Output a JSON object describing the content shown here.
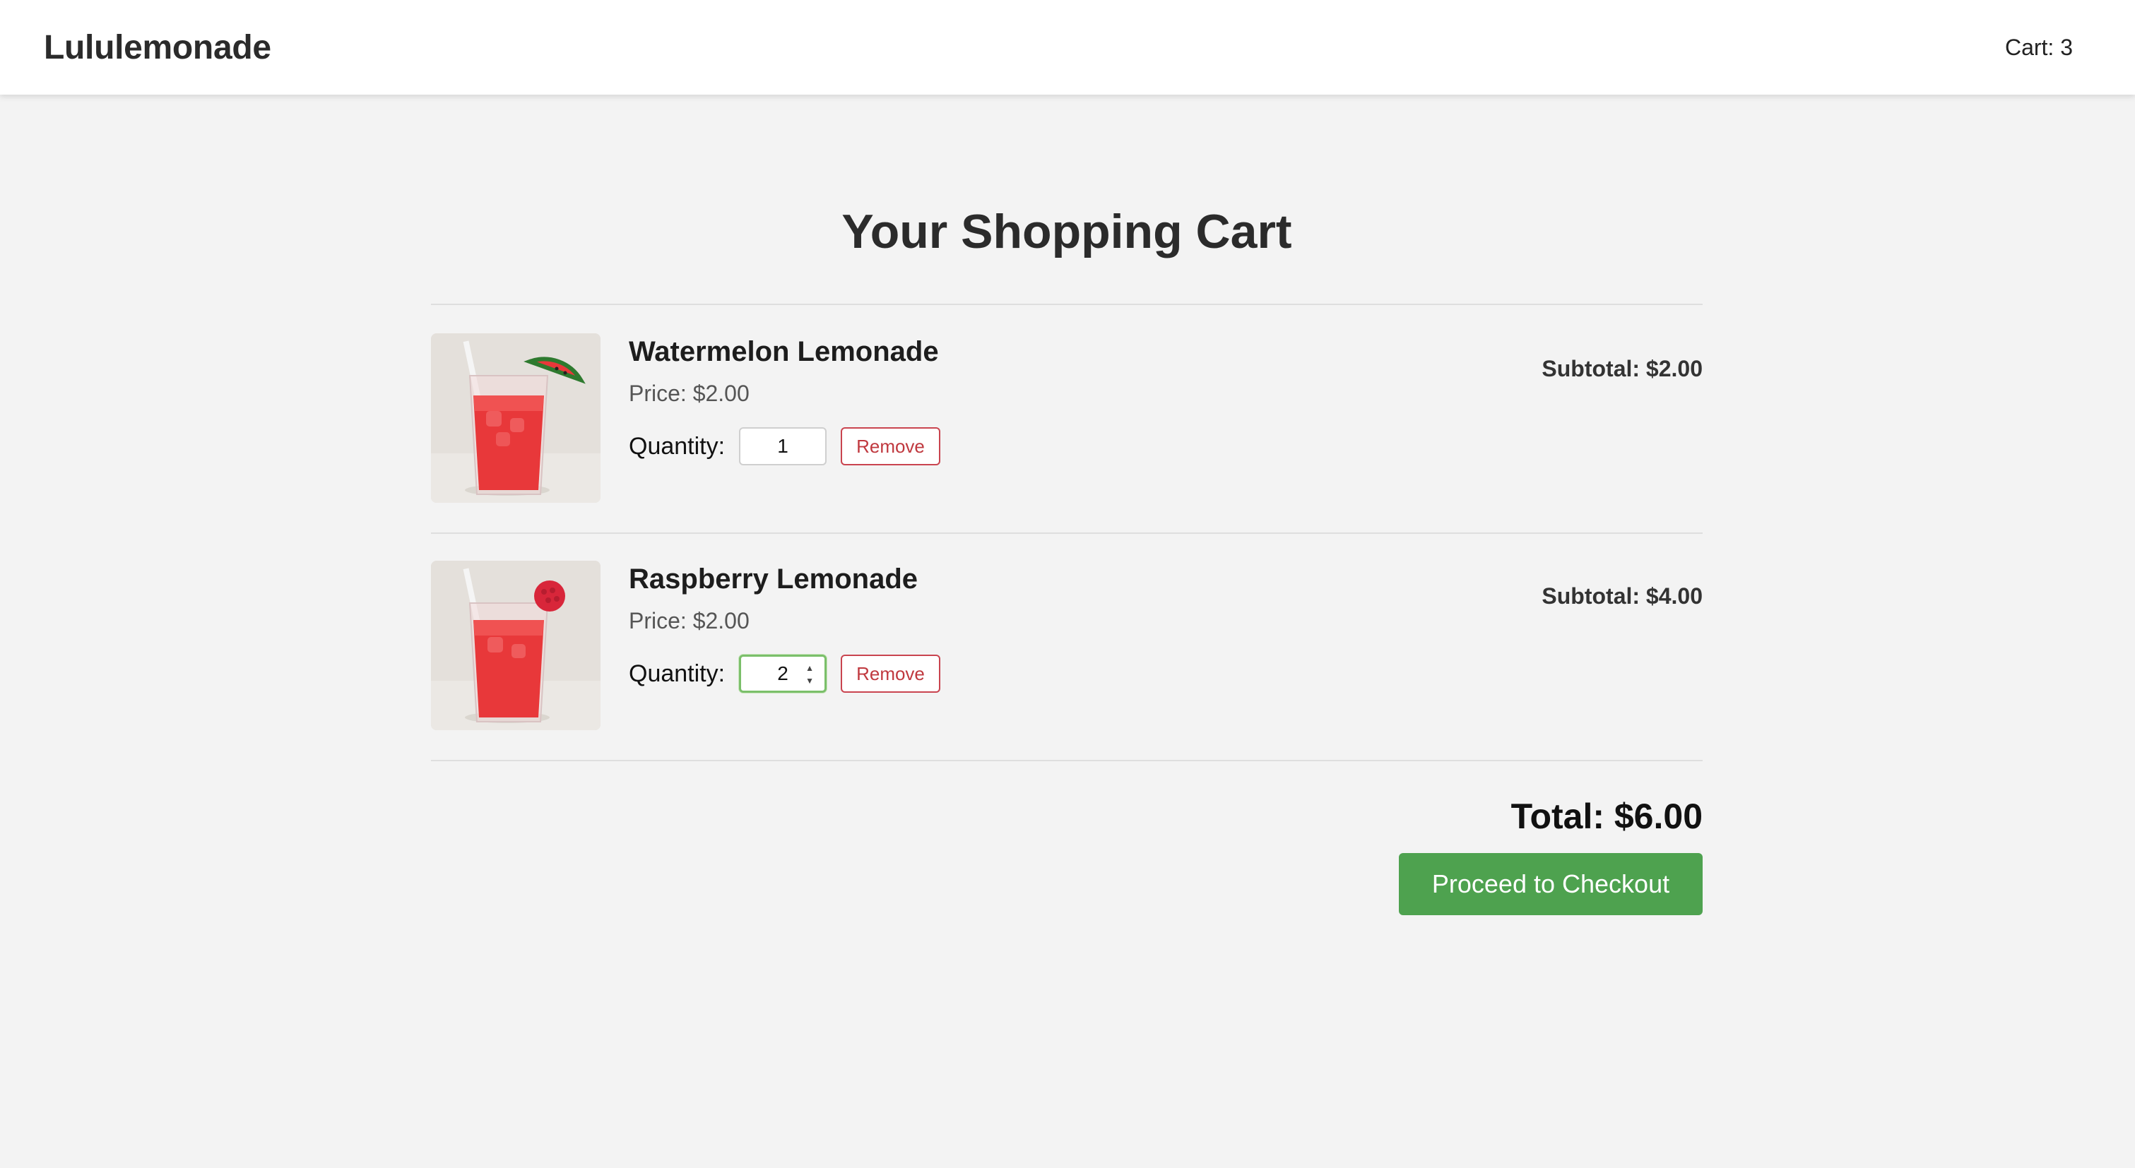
{
  "header": {
    "brand": "Lululemonade",
    "cart_label": "Cart: 3"
  },
  "main": {
    "title": "Your Shopping Cart",
    "items": [
      {
        "name": "Watermelon Lemonade",
        "price": "Price: $2.00",
        "quantity_label": "Quantity:",
        "quantity": "1",
        "remove_label": "Remove",
        "subtotal": "Subtotal: $2.00",
        "image_icon": "watermelon-lemonade-image"
      },
      {
        "name": "Raspberry Lemonade",
        "price": "Price: $2.00",
        "quantity_label": "Quantity:",
        "quantity": "2",
        "remove_label": "Remove",
        "subtotal": "Subtotal: $4.00",
        "image_icon": "raspberry-lemonade-image"
      }
    ],
    "total": "Total: $6.00",
    "checkout_label": "Proceed to Checkout"
  },
  "colors": {
    "background": "#f3f3f3",
    "header_bg": "#ffffff",
    "checkout_green": "#4ea24f",
    "remove_red": "#c0393f",
    "focus_green": "#7bbf6a"
  }
}
